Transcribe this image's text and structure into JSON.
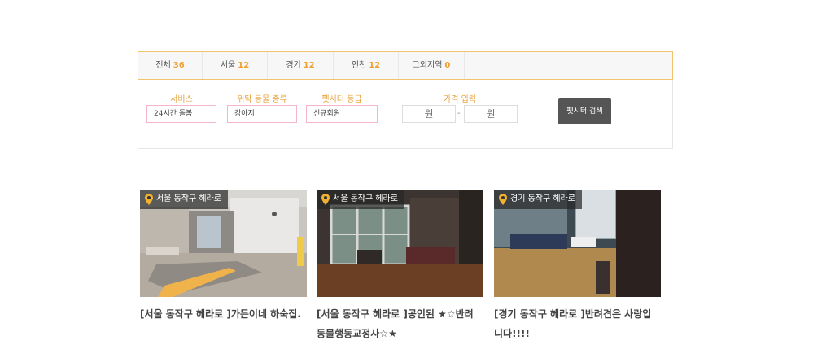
{
  "tabs": [
    {
      "label": "전체",
      "count": "36"
    },
    {
      "label": "서울",
      "count": "12"
    },
    {
      "label": "경기",
      "count": "12"
    },
    {
      "label": "인천",
      "count": "12"
    },
    {
      "label": "그외지역",
      "count": "0"
    }
  ],
  "filters": {
    "service_label": "서비스",
    "service_value": "24시간 돌봄",
    "animal_label": "위탁 동물 종류",
    "animal_value": "강아지",
    "grade_label": "펫시터 등급",
    "grade_value": "신규회원",
    "price_label": "가격 입력",
    "price_min_placeholder": "원",
    "price_max_placeholder": "원",
    "price_separator": "-",
    "search_button": "펫시터 검색"
  },
  "listings": [
    {
      "location": "서울 동작구 헤라로",
      "title": "[서울 동작구 헤라로 ]가든이네 하숙집."
    },
    {
      "location": "서울 동작구 헤라로",
      "title": "[서울 동작구 헤라로 ]공인된 ★☆반려동물행동교정사☆★"
    },
    {
      "location": "경기 동작구 헤라로",
      "title": "[경기 동작구 헤라로 ]반려견은 사랑입니다!!!!"
    }
  ],
  "colors": {
    "accent": "#f0a030",
    "tab_border": "#f0c36d",
    "input_border": "#f2b6c6",
    "button": "#555555"
  }
}
